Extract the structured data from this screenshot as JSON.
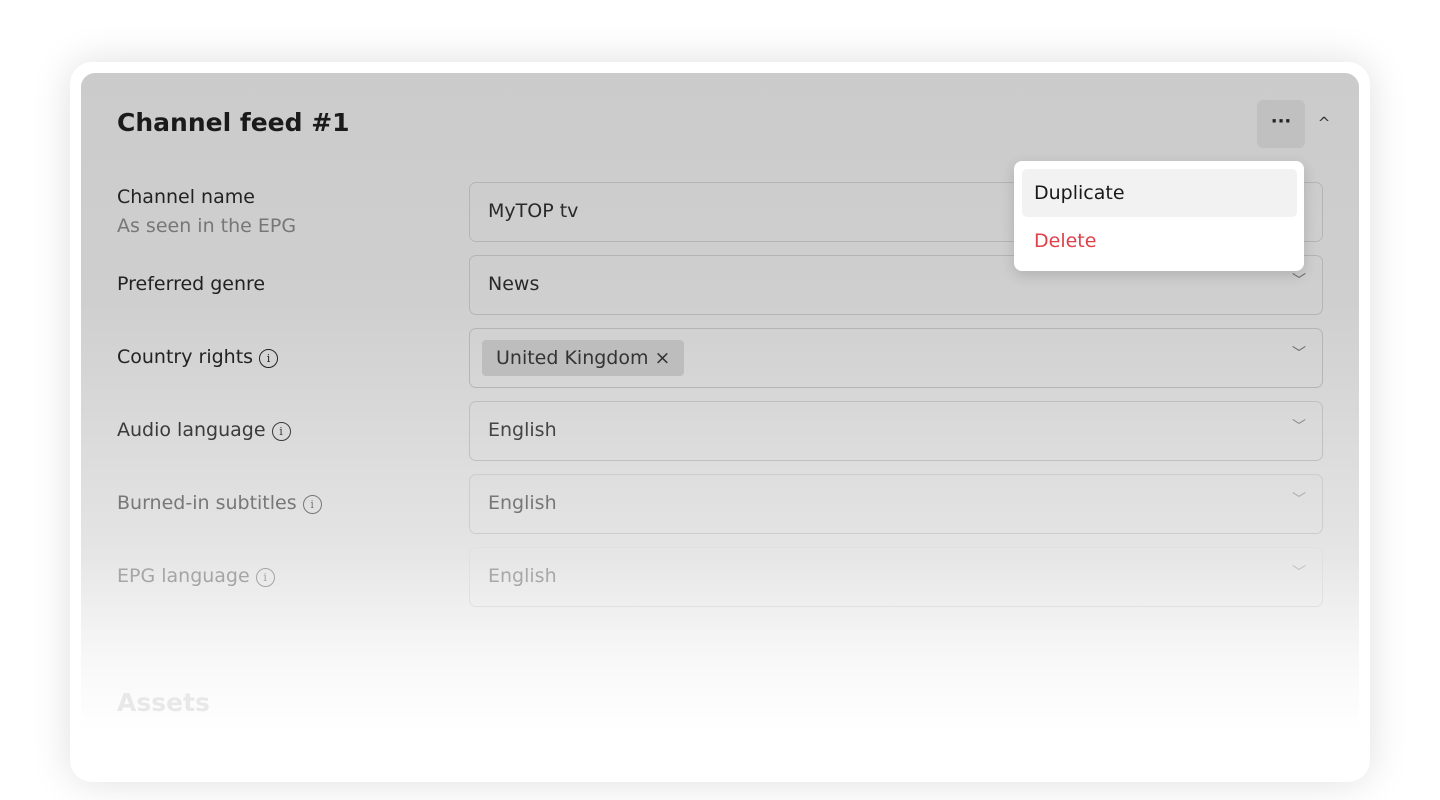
{
  "card": {
    "title": "Channel feed #1",
    "more_label": "···",
    "collapse_label": "^"
  },
  "menu": {
    "duplicate": "Duplicate",
    "delete": "Delete",
    "delete_color": "#e0414a"
  },
  "fields": {
    "channel_name": {
      "label": "Channel name",
      "hint": "As seen in the EPG",
      "value": "MyTOP tv"
    },
    "genre": {
      "label": "Preferred genre",
      "value": "News"
    },
    "country": {
      "label": "Country rights",
      "chip": "United Kingdom",
      "chip_remove": "×"
    },
    "audio": {
      "label": "Audio language",
      "value": "English"
    },
    "subtitles": {
      "label": "Burned-in subtitles",
      "value": "English"
    },
    "epg_language": {
      "label": "EPG language",
      "value": "English"
    }
  },
  "icons": {
    "info": "i",
    "chevron": "﹀"
  },
  "sections": {
    "assets": "Assets"
  }
}
